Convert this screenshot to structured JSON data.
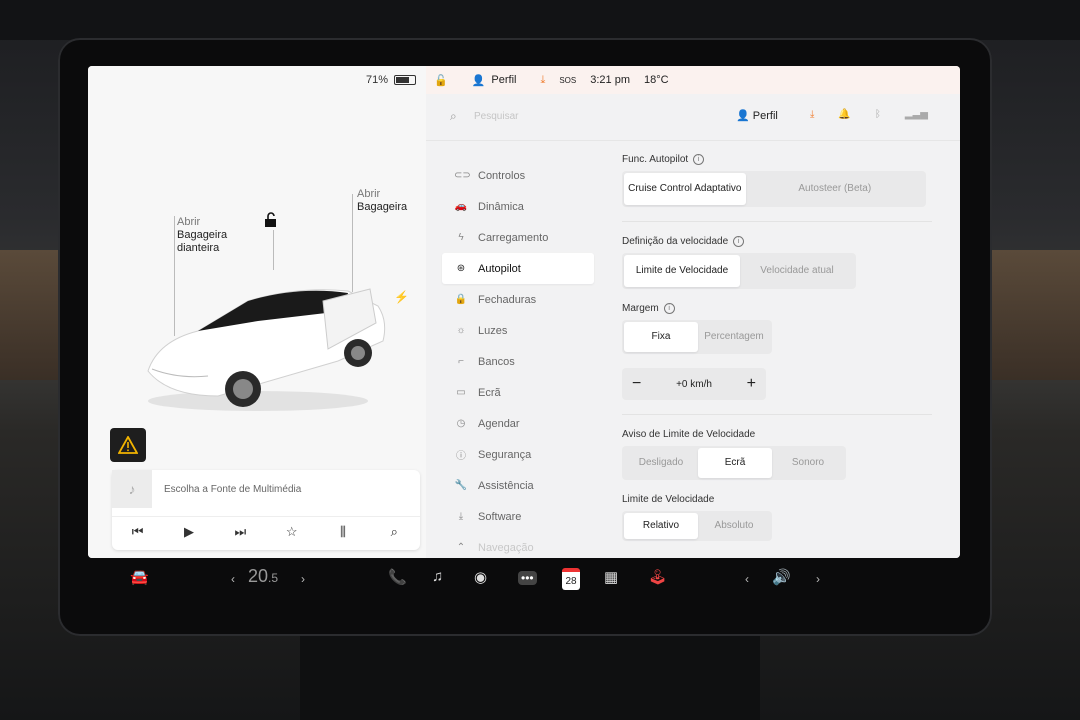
{
  "status_bar": {
    "battery": "71%",
    "profile": "Perfil",
    "sos": "SOS",
    "time": "3:21 pm",
    "temperature": "18°C"
  },
  "car": {
    "callout_front_prefix": "Abrir",
    "callout_front": "Bagageira dianteira",
    "callout_rear_prefix": "Abrir",
    "callout_rear": "Bagageira"
  },
  "media": {
    "source": "Escolha a Fonte de Multimédia"
  },
  "settings": {
    "search_placeholder": "Pesquisar",
    "profile": "Perfil",
    "nav": [
      {
        "label": "Controlos",
        "icon": "toggle-icon"
      },
      {
        "label": "Dinâmica",
        "icon": "car-icon"
      },
      {
        "label": "Carregamento",
        "icon": "bolt-icon"
      },
      {
        "label": "Autopilot",
        "icon": "steering-wheel-icon"
      },
      {
        "label": "Fechaduras",
        "icon": "lock-icon"
      },
      {
        "label": "Luzes",
        "icon": "sun-icon"
      },
      {
        "label": "Bancos",
        "icon": "seat-icon"
      },
      {
        "label": "Ecrã",
        "icon": "display-icon"
      },
      {
        "label": "Agendar",
        "icon": "clock-icon"
      },
      {
        "label": "Segurança",
        "icon": "shield-icon"
      },
      {
        "label": "Assistência",
        "icon": "wrench-icon"
      },
      {
        "label": "Software",
        "icon": "download-icon"
      },
      {
        "label": "Navegação",
        "icon": "navigation-icon"
      }
    ],
    "autopilot_features": {
      "label": "Func. Autopilot",
      "options": [
        "Cruise Control Adaptativo",
        "Autosteer (Beta)"
      ]
    },
    "speed_definition": {
      "label": "Definição da velocidade",
      "options": [
        "Limite de Velocidade",
        "Velocidade atual"
      ]
    },
    "margin": {
      "label": "Margem",
      "options": [
        "Fixa",
        "Percentagem"
      ],
      "value": "+0 km/h"
    },
    "speed_warning": {
      "label": "Aviso de Limite de Velocidade",
      "options": [
        "Desligado",
        "Ecrã",
        "Sonoro"
      ]
    },
    "speed_limit": {
      "label": "Limite de Velocidade",
      "options": [
        "Relativo",
        "Absoluto"
      ]
    }
  },
  "bottom_bar": {
    "temp_whole": "20",
    "temp_decimal": ".5",
    "calendar_day": "28"
  }
}
